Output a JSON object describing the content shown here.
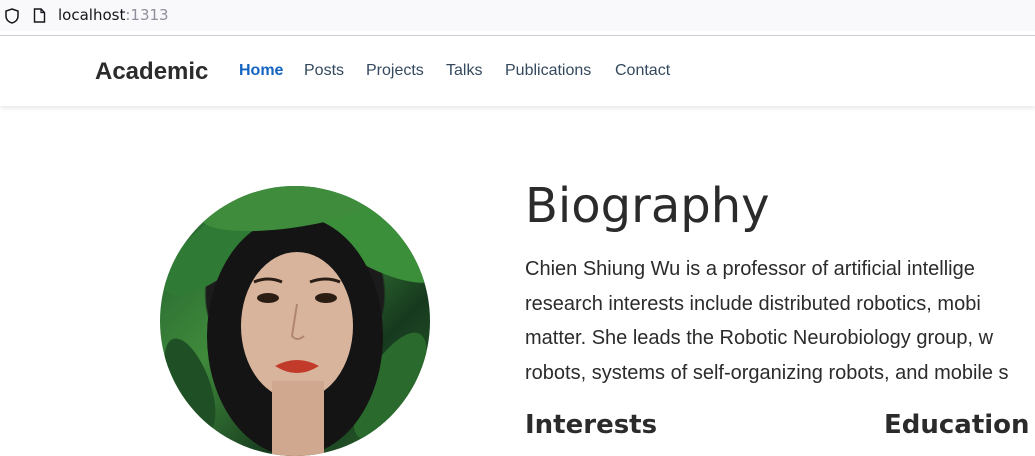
{
  "browser": {
    "url_host": "localhost",
    "url_port": ":1313"
  },
  "navbar": {
    "brand": "Academic",
    "links": [
      {
        "label": "Home",
        "active": true
      },
      {
        "label": "Posts"
      },
      {
        "label": "Projects"
      },
      {
        "label": "Talks"
      },
      {
        "label": "Publications"
      },
      {
        "label": "Contact"
      }
    ]
  },
  "biography": {
    "title": "Biography",
    "lines": [
      "Chien Shiung Wu is a professor of artificial intellige",
      "research interests include distributed robotics, mobi",
      "matter. She leads the Robotic Neurobiology group, w",
      "robots, systems of self-organizing robots, and mobile s"
    ]
  },
  "sections": {
    "interests": "Interests",
    "education": "Education"
  },
  "colors": {
    "accent": "#1565c0",
    "text": "#2b2b2b"
  }
}
